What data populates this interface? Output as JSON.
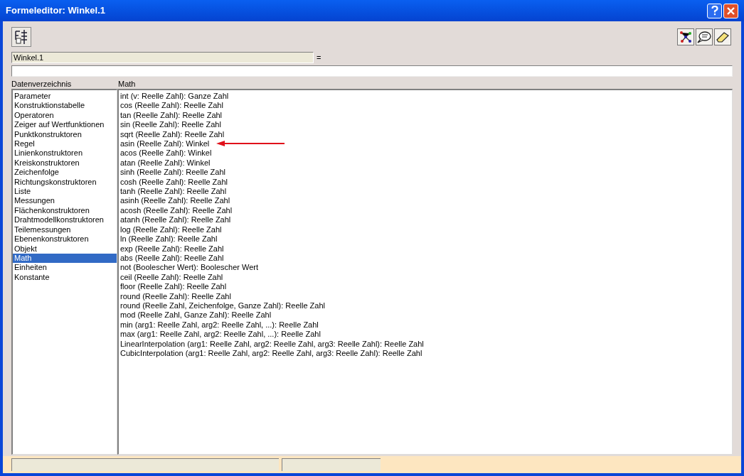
{
  "window": {
    "title": "Formeleditor: Winkel.1"
  },
  "formula": {
    "name": "Winkel.1",
    "equals": "="
  },
  "dictionary": {
    "label": "Datenverzeichnis",
    "items": [
      {
        "label": "Parameter",
        "selected": false
      },
      {
        "label": "Konstruktionstabelle",
        "selected": false
      },
      {
        "label": "Operatoren",
        "selected": false
      },
      {
        "label": "Zeiger auf Wertfunktionen",
        "selected": false
      },
      {
        "label": "Punktkonstruktoren",
        "selected": false
      },
      {
        "label": "Regel",
        "selected": false
      },
      {
        "label": "Linienkonstruktoren",
        "selected": false
      },
      {
        "label": "Kreiskonstruktoren",
        "selected": false
      },
      {
        "label": "Zeichenfolge",
        "selected": false
      },
      {
        "label": "Richtungskonstruktoren",
        "selected": false
      },
      {
        "label": "Liste",
        "selected": false
      },
      {
        "label": "Messungen",
        "selected": false
      },
      {
        "label": "Flächenkonstruktoren",
        "selected": false
      },
      {
        "label": "Drahtmodellkonstruktoren",
        "selected": false
      },
      {
        "label": "Teilemessungen",
        "selected": false
      },
      {
        "label": "Ebenenkonstruktoren",
        "selected": false
      },
      {
        "label": "Objekt",
        "selected": false
      },
      {
        "label": "Math",
        "selected": true
      },
      {
        "label": "Einheiten",
        "selected": false
      },
      {
        "label": "Konstante",
        "selected": false
      }
    ]
  },
  "members": {
    "label": "Math",
    "items": [
      "int (v: Reelle Zahl): Ganze Zahl",
      "cos (Reelle Zahl): Reelle Zahl",
      "tan (Reelle Zahl): Reelle Zahl",
      "sin (Reelle Zahl): Reelle Zahl",
      "sqrt (Reelle Zahl): Reelle Zahl",
      "asin (Reelle Zahl): Winkel",
      "acos (Reelle Zahl): Winkel",
      "atan (Reelle Zahl): Winkel",
      "sinh (Reelle Zahl): Reelle Zahl",
      "cosh (Reelle Zahl): Reelle Zahl",
      "tanh (Reelle Zahl): Reelle Zahl",
      "asinh (Reelle Zahl): Reelle Zahl",
      "acosh (Reelle Zahl): Reelle Zahl",
      "atanh (Reelle Zahl): Reelle Zahl",
      "log (Reelle Zahl): Reelle Zahl",
      "ln (Reelle Zahl): Reelle Zahl",
      "exp (Reelle Zahl): Reelle Zahl",
      "abs (Reelle Zahl): Reelle Zahl",
      "not (Boolescher Wert): Boolescher Wert",
      "ceil (Reelle Zahl): Reelle Zahl",
      "floor (Reelle Zahl): Reelle Zahl",
      "round (Reelle Zahl): Reelle Zahl",
      "round (Reelle Zahl, Zeichenfolge, Ganze Zahl): Reelle Zahl",
      "mod (Reelle Zahl, Ganze Zahl): Reelle Zahl",
      "min (arg1: Reelle Zahl, arg2: Reelle Zahl, ...): Reelle Zahl",
      "max (arg1: Reelle Zahl, arg2: Reelle Zahl, ...): Reelle Zahl",
      "LinearInterpolation (arg1: Reelle Zahl, arg2: Reelle Zahl, arg3: Reelle Zahl): Reelle Zahl",
      "CubicInterpolation (arg1: Reelle Zahl, arg2: Reelle Zahl, arg3: Reelle Zahl): Reelle Zahl"
    ]
  }
}
